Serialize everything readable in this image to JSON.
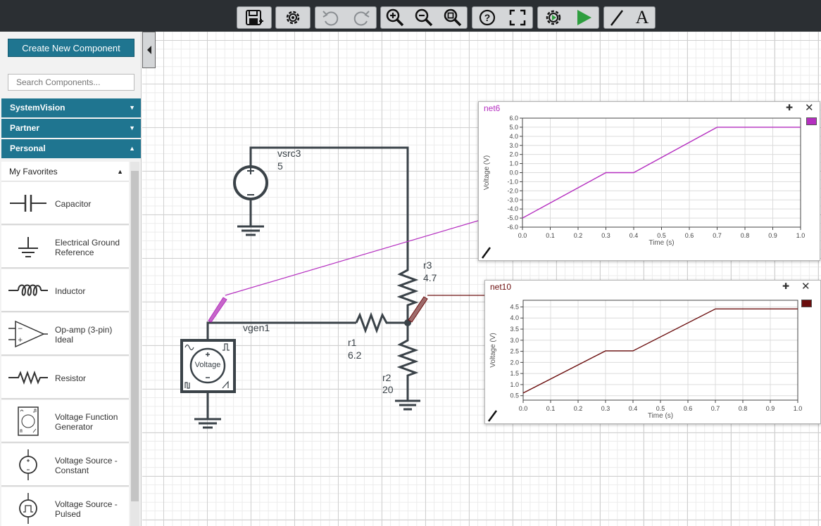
{
  "toolbar": {
    "buttons": [
      "save-icon",
      "settings-icon",
      "undo-icon",
      "redo-icon",
      "zoom-in-icon",
      "zoom-out-icon",
      "zoom-fit-icon",
      "help-icon",
      "fullscreen-icon",
      "simulation-settings-icon",
      "run-icon",
      "wire-icon",
      "text-icon"
    ],
    "text_tool_label": "A",
    "help_label": "?"
  },
  "sidebar": {
    "create_label": "Create New Component",
    "search_placeholder": "Search Components...",
    "categories": [
      {
        "label": "SystemVision",
        "arrow": "▼"
      },
      {
        "label": "Partner",
        "arrow": "▼"
      },
      {
        "label": "Personal",
        "arrow": "▲"
      }
    ],
    "favorites": {
      "label": "My Favorites",
      "arrow": "▲"
    },
    "components": [
      {
        "label": "Capacitor",
        "icon": "capacitor-icon"
      },
      {
        "label": "Electrical Ground Reference",
        "icon": "ground-icon"
      },
      {
        "label": "Inductor",
        "icon": "inductor-icon"
      },
      {
        "label": "Op-amp (3-pin) Ideal",
        "icon": "opamp-icon"
      },
      {
        "label": "Resistor",
        "icon": "resistor-icon"
      },
      {
        "label": "Voltage Function Generator",
        "icon": "function-generator-icon"
      },
      {
        "label": "Voltage Source - Constant",
        "icon": "voltage-source-icon"
      },
      {
        "label": "Voltage Source - Pulsed",
        "icon": "pulsed-source-icon"
      }
    ]
  },
  "schematic": {
    "vsrc3": {
      "name": "vsrc3",
      "value": "5"
    },
    "vgen1": {
      "name": "vgen1",
      "inner": "Voltage"
    },
    "r1": {
      "name": "r1",
      "value": "6.2"
    },
    "r2": {
      "name": "r2",
      "value": "20"
    },
    "r3": {
      "name": "r3",
      "value": "4.7"
    }
  },
  "colors": {
    "toolbar_bg": "#2b2f33",
    "accent": "#1f7590",
    "wire": "#3a4248",
    "net6": "#b52fc0",
    "net10": "#6b0e0e"
  },
  "plots": [
    {
      "title": "net6",
      "color": "#b52fc0",
      "ylabel": "Voltage (V)",
      "xlabel": "Time (s)",
      "yticks": [
        "6.0",
        "5.0",
        "4.0",
        "3.0",
        "2.0",
        "1.0",
        "0.0",
        "-1.0",
        "-2.0",
        "-3.0",
        "-4.0",
        "-5.0",
        "-6.0"
      ],
      "xticks": [
        "0.0",
        "0.1",
        "0.2",
        "0.3",
        "0.4",
        "0.5",
        "0.6",
        "0.7",
        "0.8",
        "0.9",
        "1.0"
      ]
    },
    {
      "title": "net10",
      "color": "#6b0e0e",
      "ylabel": "Voltage (V)",
      "xlabel": "Time (s)",
      "yticks": [
        "4.5",
        "4.0",
        "3.5",
        "3.0",
        "2.5",
        "2.0",
        "1.5",
        "1.0",
        "0.5"
      ],
      "xticks": [
        "0.0",
        "0.1",
        "0.2",
        "0.3",
        "0.4",
        "0.5",
        "0.6",
        "0.7",
        "0.8",
        "0.9",
        "1.0"
      ]
    }
  ],
  "chart_data": [
    {
      "type": "line",
      "title": "net6",
      "xlabel": "Time (s)",
      "ylabel": "Voltage (V)",
      "xlim": [
        0,
        1.0
      ],
      "ylim": [
        -6.0,
        6.0
      ],
      "grid": true,
      "series": [
        {
          "name": "net6",
          "color": "#b52fc0",
          "x": [
            0.0,
            0.3,
            0.4,
            0.7,
            1.0
          ],
          "y": [
            -5.0,
            0.0,
            0.0,
            5.0,
            5.0
          ]
        }
      ]
    },
    {
      "type": "line",
      "title": "net10",
      "xlabel": "Time (s)",
      "ylabel": "Voltage (V)",
      "xlim": [
        0,
        1.0
      ],
      "ylim": [
        0.3,
        4.8
      ],
      "grid": true,
      "series": [
        {
          "name": "net10",
          "color": "#6b0e0e",
          "x": [
            0.0,
            0.3,
            0.4,
            0.7,
            1.0
          ],
          "y": [
            0.62,
            2.52,
            2.52,
            4.41,
            4.41
          ]
        }
      ]
    }
  ]
}
